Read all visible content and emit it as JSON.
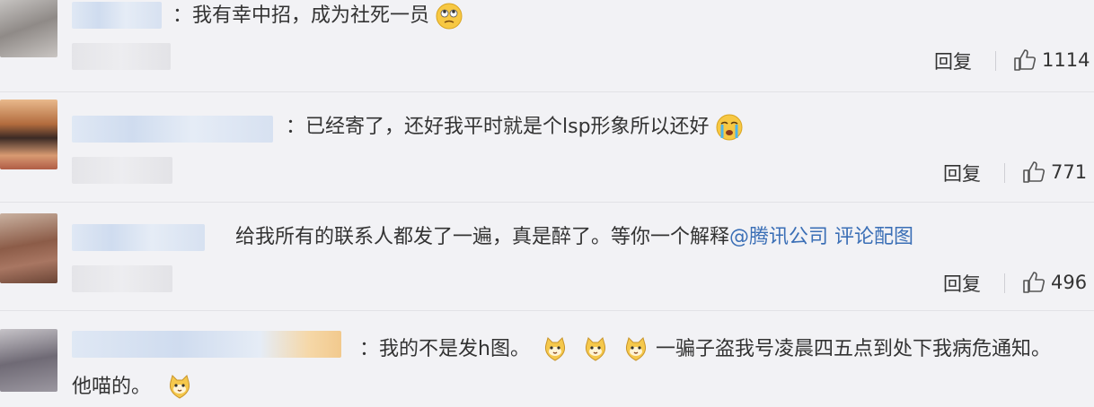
{
  "comments": [
    {
      "separator": "：",
      "text": "我有幸中招，成为社死一员",
      "emoji": "eye-roll-emoji",
      "reply_label": "回复",
      "likes": "1114"
    },
    {
      "separator": "：",
      "text": "已经寄了，还好我平时就是个lsp形象所以还好",
      "emoji": "crying-emoji",
      "reply_label": "回复",
      "likes": "771"
    },
    {
      "text": "给我所有的联系人都发了一遍，真是醉了。等你一个解释",
      "mention": "@腾讯公司",
      "image_link": "评论配图",
      "reply_label": "回复",
      "likes": "496"
    },
    {
      "separator": "：",
      "text_a": "我的不是发h图。",
      "emoji": "cat-emoji",
      "text_b": "一骗子盗我号凌晨四五点到处下我病危通知。",
      "text_c": "他喵的。"
    }
  ]
}
